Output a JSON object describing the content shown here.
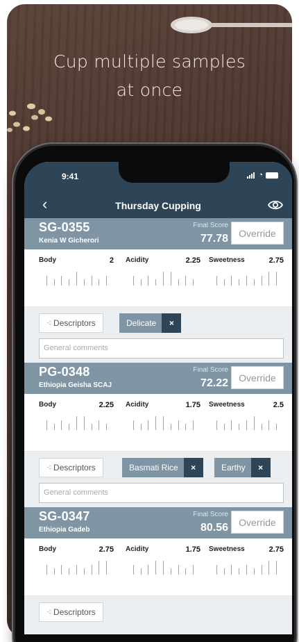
{
  "headline": [
    "Cup multiple samples",
    "at once"
  ],
  "status": {
    "time": "9:41"
  },
  "navbar": {
    "title": "Thursday Cupping",
    "back_icon": "chevron-left-icon",
    "eye_icon": "eye-icon"
  },
  "labels": {
    "final_score": "Final Score",
    "override": "Override",
    "descriptors": "Descriptors",
    "comments_placeholder": "General comments",
    "remove": "×"
  },
  "samples": [
    {
      "code": "SG-0355",
      "name": "Kenia W Gicherori",
      "final_score": "77.78",
      "scores": [
        {
          "name": "Body",
          "value": "2"
        },
        {
          "name": "Acidity",
          "value": "2.25"
        },
        {
          "name": "Sweetness",
          "value": "2.75"
        }
      ],
      "tags": [
        "Delicate"
      ]
    },
    {
      "code": "PG-0348",
      "name": "Ethiopia Geisha SCAJ",
      "final_score": "72.22",
      "scores": [
        {
          "name": "Body",
          "value": "2.25"
        },
        {
          "name": "Acidity",
          "value": "1.75"
        },
        {
          "name": "Sweetness",
          "value": "2.5"
        }
      ],
      "tags": [
        "Basmati Rice",
        "Earthy"
      ]
    },
    {
      "code": "SG-0347",
      "name": "Ethiopia Gadeb",
      "final_score": "80.56",
      "scores": [
        {
          "name": "Body",
          "value": "2.75"
        },
        {
          "name": "Acidity",
          "value": "1.75"
        },
        {
          "name": "Sweetness",
          "value": "2.75"
        }
      ],
      "tags": []
    }
  ],
  "colors": {
    "header": "#2d4556",
    "sample_head": "#7f95a4",
    "tag": "#7f95a4",
    "tag_close": "#2d4556"
  }
}
